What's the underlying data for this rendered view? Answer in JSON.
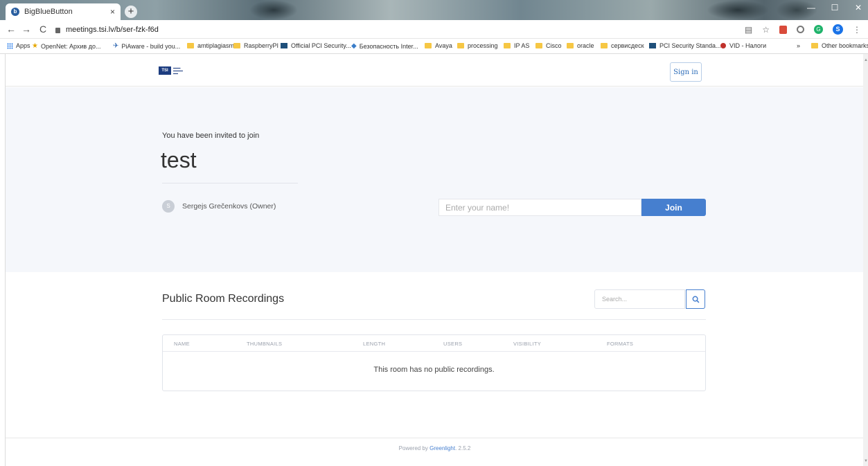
{
  "browser": {
    "tab_title": "BigBlueButton",
    "tab_close": "×",
    "new_tab": "+",
    "url": "meetings.tsi.lv/b/ser-fzk-f6d",
    "profile_initial": "S",
    "bookmarks": [
      {
        "label": "Apps",
        "icon": "apps-grid-icon"
      },
      {
        "label": "OpenNet: Архив до...",
        "icon": "star-icon"
      },
      {
        "label": "PiAware - build you...",
        "icon": "plane-icon"
      },
      {
        "label": "amtiplagiasm",
        "icon": "folder-icon"
      },
      {
        "label": "RaspberryPI",
        "icon": "folder-icon"
      },
      {
        "label": "Official PCI Security...",
        "icon": "pci-icon"
      },
      {
        "label": "Безопасность Inter...",
        "icon": "diamond-icon"
      },
      {
        "label": "Avaya",
        "icon": "folder-icon"
      },
      {
        "label": "processing",
        "icon": "folder-icon"
      },
      {
        "label": "IP AS",
        "icon": "folder-icon"
      },
      {
        "label": "Cisco",
        "icon": "folder-icon"
      },
      {
        "label": "oracle",
        "icon": "folder-icon"
      },
      {
        "label": "сервисдеск",
        "icon": "folder-icon"
      },
      {
        "label": "PCI Security Standa...",
        "icon": "pci-icon"
      },
      {
        "label": "VID - Налоги",
        "icon": "vid-icon"
      }
    ],
    "bookmarks_more": "»",
    "other_bookmarks": "Other bookmarks"
  },
  "header": {
    "logo_text": "TSI",
    "sign_in": "Sign in"
  },
  "hero": {
    "invited_text": "You have been invited to join",
    "room_name": "test",
    "owner_initial": "S",
    "owner_name": "Sergejs Grečenkovs (Owner)",
    "name_placeholder": "Enter your name!",
    "join_label": "Join"
  },
  "recordings": {
    "title": "Public Room Recordings",
    "search_placeholder": "Search...",
    "columns": [
      "NAME",
      "THUMBNAILS",
      "LENGTH",
      "USERS",
      "VISIBILITY",
      "FORMATS"
    ],
    "empty_message": "This room has no public recordings."
  },
  "footer": {
    "powered_by": "Powered by",
    "link": "Greenlight",
    "version": ". 2.5.2"
  }
}
